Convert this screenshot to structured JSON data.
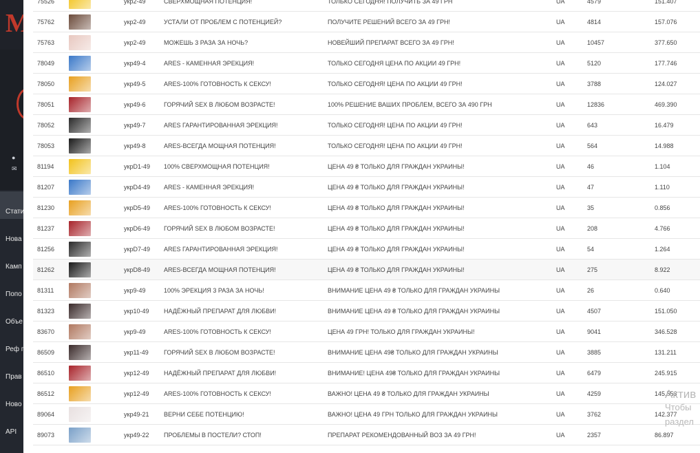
{
  "sidebar": {
    "brand_fragment": "M",
    "menu": [
      {
        "label": "Стати",
        "icon": "stats-icon"
      },
      {
        "label": "Нова",
        "icon": "new-icon"
      },
      {
        "label": "Камп",
        "icon": "campaign-icon"
      },
      {
        "label": "Попо",
        "icon": "topup-icon"
      },
      {
        "label": "Объе",
        "icon": "ads-icon"
      },
      {
        "label": "Реф п",
        "icon": "referral-icon"
      },
      {
        "label": "Прав",
        "icon": "rules-icon"
      },
      {
        "label": "Ново",
        "icon": "news-icon"
      },
      {
        "label": "API",
        "icon": "api-icon"
      }
    ]
  },
  "rows": [
    {
      "id": "75526",
      "thumb": "#f2c21b",
      "sub": "укр2-49",
      "headline": "СВЕРХМОЩНАЯ ПОТЕНЦИЯ!",
      "text": "ТОЛЬКО СЕГОДНЯ! ПОЛУЧИТЬ ЗА 49 ГРН",
      "geo": "UA",
      "clicks": "4579",
      "value": "151.407"
    },
    {
      "id": "75762",
      "thumb": "#6b4a3a",
      "sub": "укр2-49",
      "headline": "УСТАЛИ ОТ ПРОБЛЕМ С ПОТЕНЦИЕЙ?",
      "text": "ПОЛУЧИТЕ РЕШЕНИЙ ВСЕГО ЗА 49 ГРН!",
      "geo": "UA",
      "clicks": "4814",
      "value": "157.076"
    },
    {
      "id": "75763",
      "thumb": "#e8c8c0",
      "sub": "укр2-49",
      "headline": "МОЖЕШЬ 3 РАЗА ЗА НОЧЬ?",
      "text": "НОВЕЙШИЙ ПРЕПАРАТ ВСЕГО ЗА 49 ГРН!",
      "geo": "UA",
      "clicks": "10457",
      "value": "377.650"
    },
    {
      "id": "78049",
      "thumb": "#3a78c8",
      "sub": "укр49-4",
      "headline": "ARES - КАМЕННАЯ ЭРЕКЦИЯ!",
      "text": "ТОЛЬКО СЕГОДНЯ ЦЕНА ПО АКЦИИ 49 ГРН!",
      "geo": "UA",
      "clicks": "5120",
      "value": "177.746"
    },
    {
      "id": "78050",
      "thumb": "#e8a020",
      "sub": "укр49-5",
      "headline": "ARES-100% ГОТОВНОСТЬ К СЕКСУ!",
      "text": "ТОЛЬКО СЕГОДНЯ! ЦЕНА ПО АКЦИИ 49 ГРН!",
      "geo": "UA",
      "clicks": "3788",
      "value": "124.027"
    },
    {
      "id": "78051",
      "thumb": "#a8232a",
      "sub": "укр49-6",
      "headline": "ГОРЯЧИЙ SEX В ЛЮБОМ ВОЗРАСТЕ!",
      "text": "100% РЕШЕНИЕ ВАШИХ ПРОБЛЕМ, ВСЕГО ЗА 490 ГРН",
      "geo": "UA",
      "clicks": "12836",
      "value": "469.390"
    },
    {
      "id": "78052",
      "thumb": "#2a2a2a",
      "sub": "укр49-7",
      "headline": "ARES ГАРАНТИРОВАННАЯ ЭРЕКЦИЯ!",
      "text": "ТОЛЬКО СЕГОДНЯ! ЦЕНА ПО АКЦИИ 49 ГРН!",
      "geo": "UA",
      "clicks": "643",
      "value": "16.479"
    },
    {
      "id": "78053",
      "thumb": "#1a1a1a",
      "sub": "укр49-8",
      "headline": "ARES-ВСЕГДА МОЩНАЯ ПОТЕНЦИЯ!",
      "text": "ТОЛЬКО СЕГОДНЯ! ЦЕНА ПО АКЦИИ 49 ГРН!",
      "geo": "UA",
      "clicks": "564",
      "value": "14.988"
    },
    {
      "id": "81194",
      "thumb": "#f2c21b",
      "sub": "укрD1-49",
      "headline": "100% СВЕРХМОЩНАЯ ПОТЕНЦИЯ!",
      "text": "ЦЕНА 49 ₴ ТОЛЬКО ДЛЯ ГРАЖДАН УКРАИНЫ!",
      "geo": "UA",
      "clicks": "46",
      "value": "1.104"
    },
    {
      "id": "81207",
      "thumb": "#3a78c8",
      "sub": "укрD4-49",
      "headline": "ARES - КАМЕННАЯ ЭРЕКЦИЯ!",
      "text": "ЦЕНА 49 ₴ ТОЛЬКО ДЛЯ ГРАЖДАН УКРАИНЫ!",
      "geo": "UA",
      "clicks": "47",
      "value": "1.110"
    },
    {
      "id": "81230",
      "thumb": "#e8a020",
      "sub": "укрD5-49",
      "headline": "ARES-100% ГОТОВНОСТЬ К СЕКСУ!",
      "text": "ЦЕНА 49 ₴ ТОЛЬКО ДЛЯ ГРАЖДАН УКРАИНЫ!",
      "geo": "UA",
      "clicks": "35",
      "value": "0.856"
    },
    {
      "id": "81237",
      "thumb": "#a8232a",
      "sub": "укрD6-49",
      "headline": "ГОРЯЧИЙ SEX В ЛЮБОМ ВОЗРАСТЕ!",
      "text": "ЦЕНА 49 ₴ ТОЛЬКО ДЛЯ ГРАЖДАН УКРАИНЫ!",
      "geo": "UA",
      "clicks": "208",
      "value": "4.766"
    },
    {
      "id": "81256",
      "thumb": "#2a2a2a",
      "sub": "укрD7-49",
      "headline": "ARES ГАРАНТИРОВАННАЯ ЭРЕКЦИЯ!",
      "text": "ЦЕНА 49 ₴ ТОЛЬКО ДЛЯ ГРАЖДАН УКРАИНЫ!",
      "geo": "UA",
      "clicks": "54",
      "value": "1.264"
    },
    {
      "id": "81262",
      "thumb": "#1a1a1a",
      "sub": "укрD8-49",
      "headline": "ARES-ВСЕГДА МОЩНАЯ ПОТЕНЦИЯ!",
      "text": "ЦЕНА 49 ₴ ТОЛЬКО ДЛЯ ГРАЖДАН УКРАИНЫ!",
      "geo": "UA",
      "clicks": "275",
      "value": "8.922"
    },
    {
      "id": "81311",
      "thumb": "#b07860",
      "sub": "укр9-49",
      "headline": "100% ЭРЕКЦИЯ 3 РАЗА ЗА НОЧЬ!",
      "text": "ВНИМАНИЕ ЦЕНА 49 ₴ ТОЛЬКО ДЛЯ ГРАЖДАН УКРАИНЫ",
      "geo": "UA",
      "clicks": "26",
      "value": "0.640"
    },
    {
      "id": "81323",
      "thumb": "#3a2a2a",
      "sub": "укр10-49",
      "headline": "НАДЁЖНЫЙ ПРЕПАРАТ ДЛЯ ЛЮБВИ!",
      "text": "ВНИМАНИЕ ЦЕНА 49 ₴ ТОЛЬКО ДЛЯ ГРАЖДАН УКРАИНЫ",
      "geo": "UA",
      "clicks": "4507",
      "value": "151.050"
    },
    {
      "id": "83670",
      "thumb": "#b07860",
      "sub": "укр9-49",
      "headline": "ARES-100% ГОТОВНОСТЬ К СЕКСУ!",
      "text": "ЦЕНА 49 ГРН! ТОЛЬКО ДЛЯ ГРАЖДАН УКРАИНЫ!",
      "geo": "UA",
      "clicks": "9041",
      "value": "346.528"
    },
    {
      "id": "86509",
      "thumb": "#3a2a2a",
      "sub": "укр11-49",
      "headline": "ГОРЯЧИЙ SEX В ЛЮБОМ ВОЗРАСТЕ!",
      "text": "ВНИМАНИЕ ЦЕНА 49₴ ТОЛЬКО ДЛЯ ГРАЖДАН УКРАИНЫ",
      "geo": "UA",
      "clicks": "3885",
      "value": "131.211"
    },
    {
      "id": "86510",
      "thumb": "#a8232a",
      "sub": "укр12-49",
      "headline": "НАДЁЖНЫЙ ПРЕПАРАТ ДЛЯ ЛЮБВИ!",
      "text": "ВНИМАНИЕ! ЦЕНА 49₴ ТОЛЬКО ДЛЯ ГРАЖДАН УКРАИНЫ",
      "geo": "UA",
      "clicks": "6479",
      "value": "245.915"
    },
    {
      "id": "86512",
      "thumb": "#e8a020",
      "sub": "укр12-49",
      "headline": "ARES-100% ГОТОВНОСТЬ К СЕКСУ!",
      "text": "ВАЖНО! ЦЕНА 49 ₴ ТОЛЬКО ДЛЯ ГРАЖДАН УКРАИНЫ",
      "geo": "UA",
      "clicks": "4259",
      "value": "145.556"
    },
    {
      "id": "89064",
      "thumb": "#e8e0e0",
      "sub": "укр49-21",
      "headline": "ВЕРНИ СЕБЕ ПОТЕНЦИЮ!",
      "text": "ВАЖНО! ЦЕНА 49 ГРН ТОЛЬКО ДЛЯ ГРАЖДАН УКРАИНЫ",
      "geo": "UA",
      "clicks": "3762",
      "value": "142.377"
    },
    {
      "id": "89073",
      "thumb": "#7aa0c8",
      "sub": "укр49-22",
      "headline": "ПРОБЛЕМЫ В ПОСТЕЛИ? СТОП!",
      "text": "ПРЕПАРАТ РЕКОМЕНДОВАННЫЙ ВОЗ ЗА 49 ГРН!",
      "geo": "UA",
      "clicks": "2357",
      "value": "86.897"
    }
  ],
  "watermark": {
    "line1": "Актив",
    "line2": "Чтобы",
    "line3": "раздел"
  }
}
